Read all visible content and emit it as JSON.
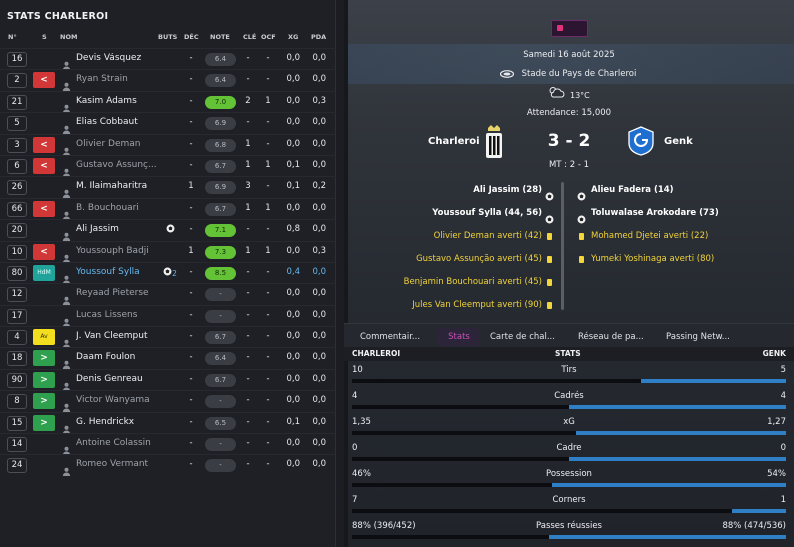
{
  "left": {
    "title": "STATS CHARLEROI",
    "headers": {
      "num": "N°",
      "s": "S",
      "name": "NOM",
      "buts": "BUTS",
      "dec": "DÉC",
      "note": "NOTE",
      "cle": "CLÉ",
      "ocf": "OCF",
      "xg": "XG",
      "pda": "PDA"
    },
    "players": [
      {
        "num": "16",
        "status": "",
        "name": "Devis Vásquez",
        "buts": "",
        "dec": "-",
        "note": "6.4",
        "cle": "-",
        "ocf": "-",
        "xg": "0,0",
        "pda": "0,0"
      },
      {
        "num": "2",
        "status": "out",
        "name": "Ryan Strain",
        "buts": "",
        "dec": "-",
        "note": "6.4",
        "cle": "-",
        "ocf": "-",
        "xg": "0,0",
        "pda": "0,0"
      },
      {
        "num": "21",
        "status": "",
        "name": "Kasim Adams",
        "buts": "",
        "dec": "-",
        "note": "7.0",
        "cle": "2",
        "ocf": "1",
        "xg": "0,0",
        "pda": "0,3"
      },
      {
        "num": "5",
        "status": "",
        "name": "Elias Cobbaut",
        "buts": "",
        "dec": "-",
        "note": "6.9",
        "cle": "-",
        "ocf": "-",
        "xg": "0,0",
        "pda": "0,0"
      },
      {
        "num": "3",
        "status": "out",
        "name": "Olivier Deman",
        "buts": "",
        "dec": "-",
        "note": "6.8",
        "cle": "1",
        "ocf": "-",
        "xg": "0,0",
        "pda": "0,0"
      },
      {
        "num": "6",
        "status": "out",
        "name": "Gustavo Assunç...",
        "buts": "",
        "dec": "-",
        "note": "6.7",
        "cle": "1",
        "ocf": "1",
        "xg": "0,1",
        "pda": "0,0"
      },
      {
        "num": "26",
        "status": "",
        "name": "M. Ilaimaharitra",
        "buts": "",
        "dec": "1",
        "note": "6.9",
        "cle": "3",
        "ocf": "-",
        "xg": "0,1",
        "pda": "0,2"
      },
      {
        "num": "66",
        "status": "out",
        "name": "B. Bouchouari",
        "buts": "",
        "dec": "-",
        "note": "6.7",
        "cle": "1",
        "ocf": "1",
        "xg": "0,0",
        "pda": "0,0"
      },
      {
        "num": "20",
        "status": "",
        "name": "Ali Jassim",
        "buts": "ball",
        "dec": "-",
        "note": "7.1",
        "cle": "-",
        "ocf": "-",
        "xg": "0,8",
        "pda": "0,0"
      },
      {
        "num": "10",
        "status": "out",
        "name": "Youssouph Badji",
        "buts": "",
        "dec": "1",
        "note": "7.3",
        "cle": "1",
        "ocf": "1",
        "xg": "0,0",
        "pda": "0,3"
      },
      {
        "num": "80",
        "status": "hdm",
        "name": "Youssouf Sylla",
        "buts": "ball2",
        "dec": "-",
        "note": "8.5",
        "cle": "-",
        "ocf": "-",
        "xg": "0,4",
        "pda": "0,0"
      },
      {
        "num": "12",
        "status": "",
        "name": "Reyaad Pieterse",
        "buts": "",
        "dec": "-",
        "note": "-",
        "cle": "-",
        "ocf": "-",
        "xg": "0,0",
        "pda": "0,0"
      },
      {
        "num": "17",
        "status": "",
        "name": "Lucas Lissens",
        "buts": "",
        "dec": "-",
        "note": "-",
        "cle": "-",
        "ocf": "-",
        "xg": "0,0",
        "pda": "0,0"
      },
      {
        "num": "4",
        "status": "av",
        "name": "J. Van Cleemput",
        "buts": "",
        "dec": "-",
        "note": "6.7",
        "cle": "-",
        "ocf": "-",
        "xg": "0,0",
        "pda": "0,0"
      },
      {
        "num": "18",
        "status": "in",
        "name": "Daam Foulon",
        "buts": "",
        "dec": "-",
        "note": "6.4",
        "cle": "-",
        "ocf": "-",
        "xg": "0,0",
        "pda": "0,0"
      },
      {
        "num": "90",
        "status": "in",
        "name": "Denis Genreau",
        "buts": "",
        "dec": "-",
        "note": "6.7",
        "cle": "-",
        "ocf": "-",
        "xg": "0,0",
        "pda": "0,0"
      },
      {
        "num": "8",
        "status": "in",
        "name": "Victor Wanyama",
        "buts": "",
        "dec": "-",
        "note": "-",
        "cle": "-",
        "ocf": "-",
        "xg": "0,0",
        "pda": "0,0"
      },
      {
        "num": "15",
        "status": "in",
        "name": "G. Hendrickx",
        "buts": "",
        "dec": "-",
        "note": "6.5",
        "cle": "-",
        "ocf": "-",
        "xg": "0,1",
        "pda": "0,0"
      },
      {
        "num": "14",
        "status": "",
        "name": "Antoine Colassin",
        "buts": "",
        "dec": "-",
        "note": "-",
        "cle": "-",
        "ocf": "-",
        "xg": "0,0",
        "pda": "0,0"
      },
      {
        "num": "24",
        "status": "",
        "name": "Romeo Vermant",
        "buts": "",
        "dec": "-",
        "note": "-",
        "cle": "-",
        "ocf": "-",
        "xg": "0,0",
        "pda": "0,0"
      }
    ],
    "badges": {
      "av": "Av",
      "hdm": "HdM",
      "out": "<",
      "in": ">"
    },
    "sylla_goals": "2"
  },
  "match": {
    "date": "Samedi 16 août 2025",
    "stadium": "Stade du Pays de Charleroi",
    "temperature": "13°C",
    "attendance": "Attendance: 15,000",
    "home": "Charleroi",
    "away": "Genk",
    "score": "3 - 2",
    "halftime": "MT : 2 - 1",
    "home_goals": [
      "Ali Jassim (28)",
      "Youssouf Sylla (44, 56)"
    ],
    "home_cards": [
      "Olivier Deman averti (42)",
      "Gustavo Assunção averti (45)",
      "Benjamin Bouchouari averti (45)",
      "Jules Van Cleemput averti (90)"
    ],
    "away_goals": [
      "Alieu Fadera (14)",
      "Toluwalase Arokodare (73)"
    ],
    "away_cards": [
      "Mohamed Djetei averti (22)",
      "Yumeki Yoshinaga averti (80)"
    ]
  },
  "tabs": [
    "Commentair...",
    "Stats",
    "Carte de chal...",
    "Réseau de pa...",
    "Passing Netw..."
  ],
  "stats": {
    "home_label": "CHARLEROI",
    "center_label": "STATS",
    "away_label": "GENK",
    "rows": [
      {
        "label": "Tirs",
        "home": "10",
        "away": "5",
        "home_share": 0.667
      },
      {
        "label": "Cadrés",
        "home": "4",
        "away": "4",
        "home_share": 0.5
      },
      {
        "label": "xG",
        "home": "1,35",
        "away": "1,27",
        "home_share": 0.515
      },
      {
        "label": "Cadre",
        "home": "0",
        "away": "0",
        "home_share": 0.5
      },
      {
        "label": "Possession",
        "home": "46%",
        "away": "54%",
        "home_share": 0.46
      },
      {
        "label": "Corners",
        "home": "7",
        "away": "1",
        "home_share": 0.875
      },
      {
        "label": "Passes réussies",
        "home": "88% (396/452)",
        "away": "88% (474/536)",
        "home_share": 0.455
      }
    ]
  }
}
